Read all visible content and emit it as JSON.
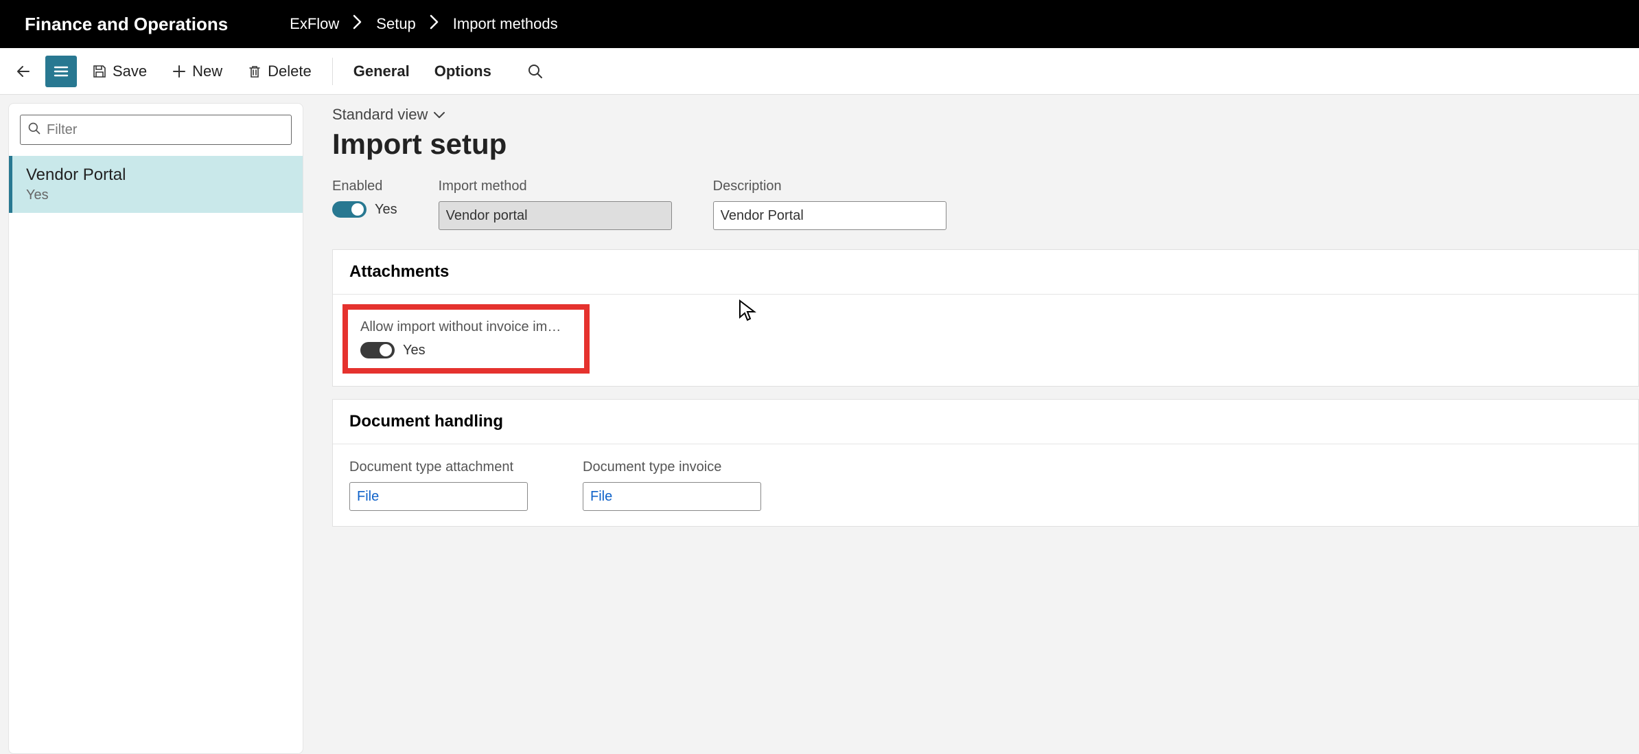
{
  "header": {
    "app_title": "Finance and Operations",
    "breadcrumbs": [
      "ExFlow",
      "Setup",
      "Import methods"
    ]
  },
  "toolbar": {
    "save_label": "Save",
    "new_label": "New",
    "delete_label": "Delete",
    "general_label": "General",
    "options_label": "Options"
  },
  "sidebar": {
    "filter_placeholder": "Filter",
    "items": [
      {
        "title": "Vendor Portal",
        "subtitle": "Yes"
      }
    ]
  },
  "content": {
    "view_label": "Standard view",
    "page_title": "Import setup",
    "fields": {
      "enabled_label": "Enabled",
      "enabled_value": "Yes",
      "import_method_label": "Import method",
      "import_method_value": "Vendor portal",
      "description_label": "Description",
      "description_value": "Vendor Portal"
    },
    "sections": {
      "attachments": {
        "title": "Attachments",
        "allow_import_label": "Allow import without invoice im…",
        "allow_import_value": "Yes"
      },
      "doc_handling": {
        "title": "Document handling",
        "doc_type_attachment_label": "Document type attachment",
        "doc_type_attachment_value": "File",
        "doc_type_invoice_label": "Document type invoice",
        "doc_type_invoice_value": "File"
      }
    }
  }
}
